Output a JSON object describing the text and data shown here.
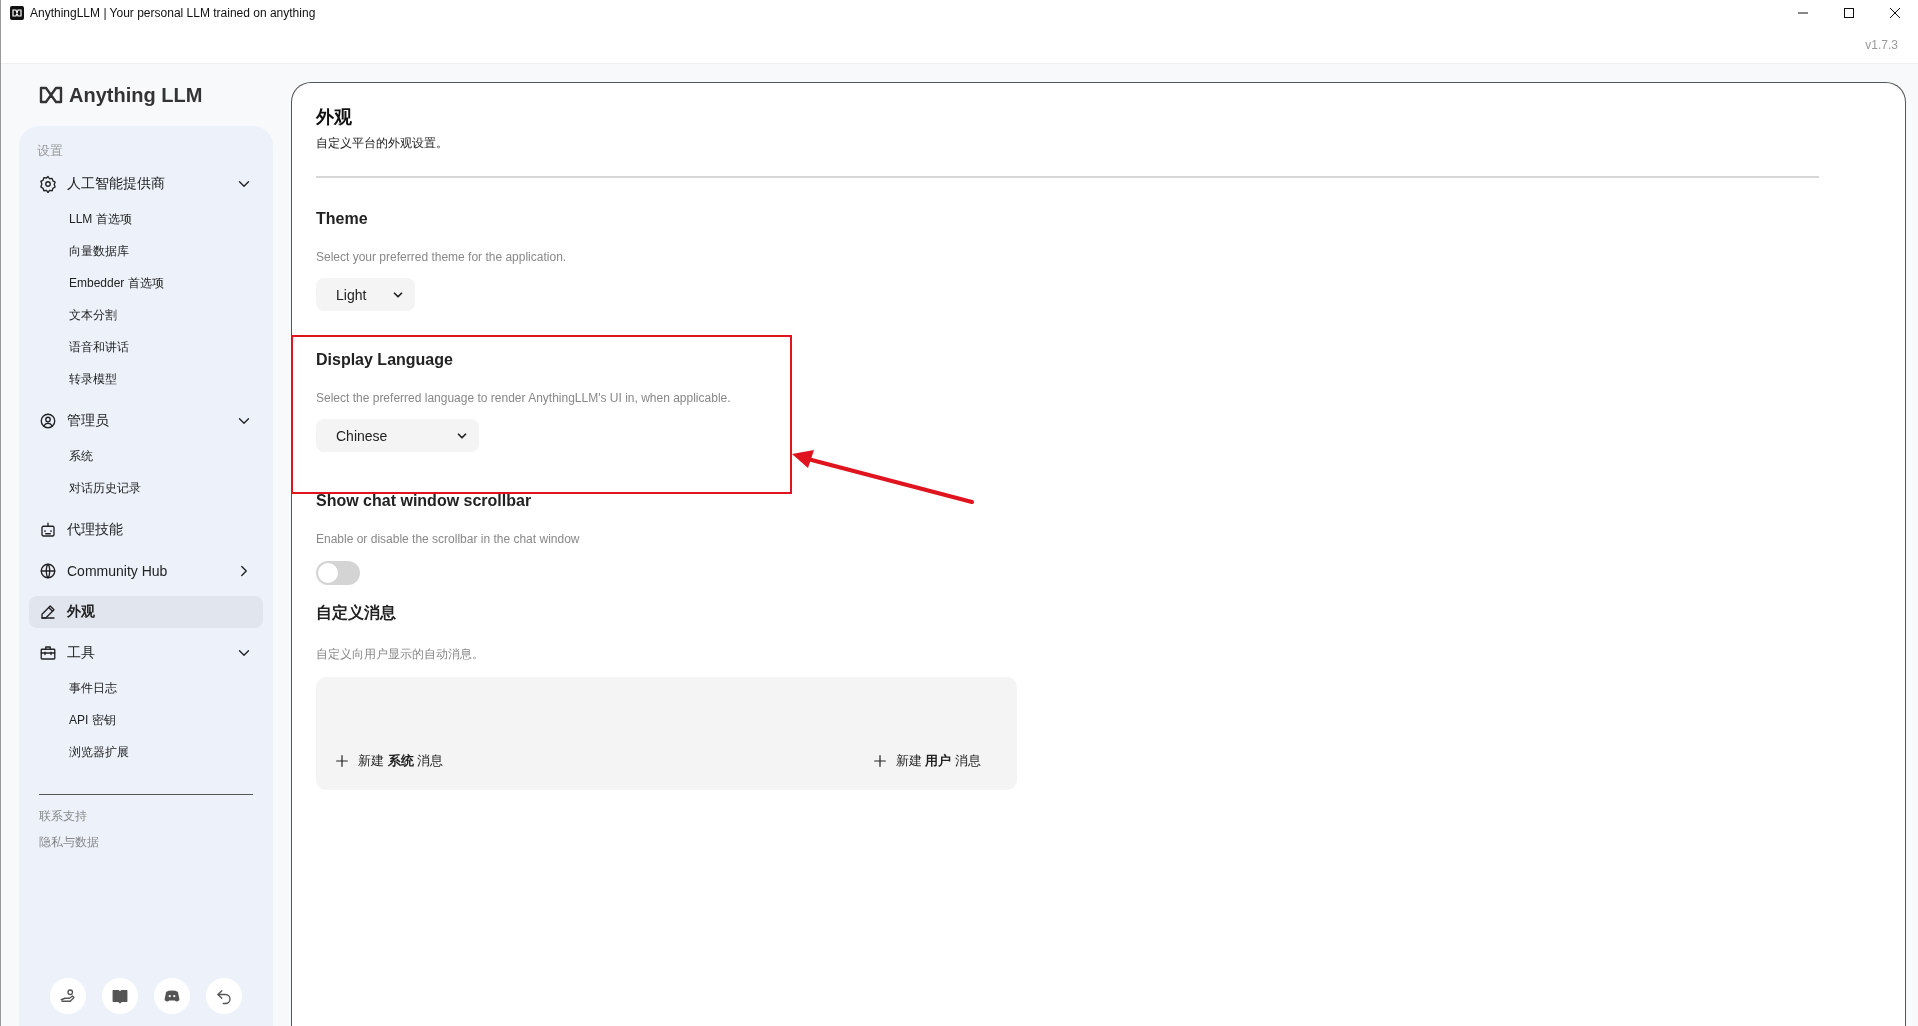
{
  "window": {
    "title": "AnythingLLM | Your personal LLM trained on anything",
    "version": "v1.7.3"
  },
  "sidebar": {
    "logo": "Anything LLM",
    "section_label": "设置",
    "items": [
      {
        "kind": "group",
        "label": "人工智能提供商",
        "expanded": true,
        "selected": false,
        "children": [
          {
            "label": "LLM 首选项"
          },
          {
            "label": "向量数据库"
          },
          {
            "label": "Embedder 首选项"
          },
          {
            "label": "文本分割"
          },
          {
            "label": "语音和讲话"
          },
          {
            "label": "转录模型"
          }
        ]
      },
      {
        "kind": "group",
        "label": "管理员",
        "expanded": true,
        "selected": false,
        "children": [
          {
            "label": "系统"
          },
          {
            "label": "对话历史记录"
          }
        ]
      },
      {
        "kind": "link",
        "label": "代理技能",
        "selected": false
      },
      {
        "kind": "nav",
        "label": "Community Hub",
        "selected": false
      },
      {
        "kind": "link",
        "label": "外观",
        "selected": true
      },
      {
        "kind": "group",
        "label": "工具",
        "expanded": true,
        "selected": false,
        "children": [
          {
            "label": "事件日志"
          },
          {
            "label": "API 密钥"
          },
          {
            "label": "浏览器扩展"
          }
        ]
      }
    ],
    "footer_links": [
      "联系支持",
      "隐私与数据"
    ]
  },
  "page": {
    "title": "外观",
    "subtitle": "自定义平台的外观设置。",
    "settings": [
      {
        "kind": "select",
        "title": "Theme",
        "description": "Select your preferred theme for the application.",
        "value": "Light"
      },
      {
        "kind": "select",
        "title": "Display Language",
        "description": "Select the preferred language to render AnythingLLM's UI in, when applicable.",
        "value": "Chinese",
        "highlighted": true
      },
      {
        "kind": "toggle",
        "title": "Show chat window scrollbar",
        "description": "Enable or disable the scrollbar in the chat window",
        "on": false
      },
      {
        "kind": "messages",
        "title": "自定义消息",
        "description": "自定义向用户显示的自动消息。",
        "buttons": [
          "新建 **系统** 消息",
          "新建 **用户** 消息"
        ]
      }
    ]
  }
}
